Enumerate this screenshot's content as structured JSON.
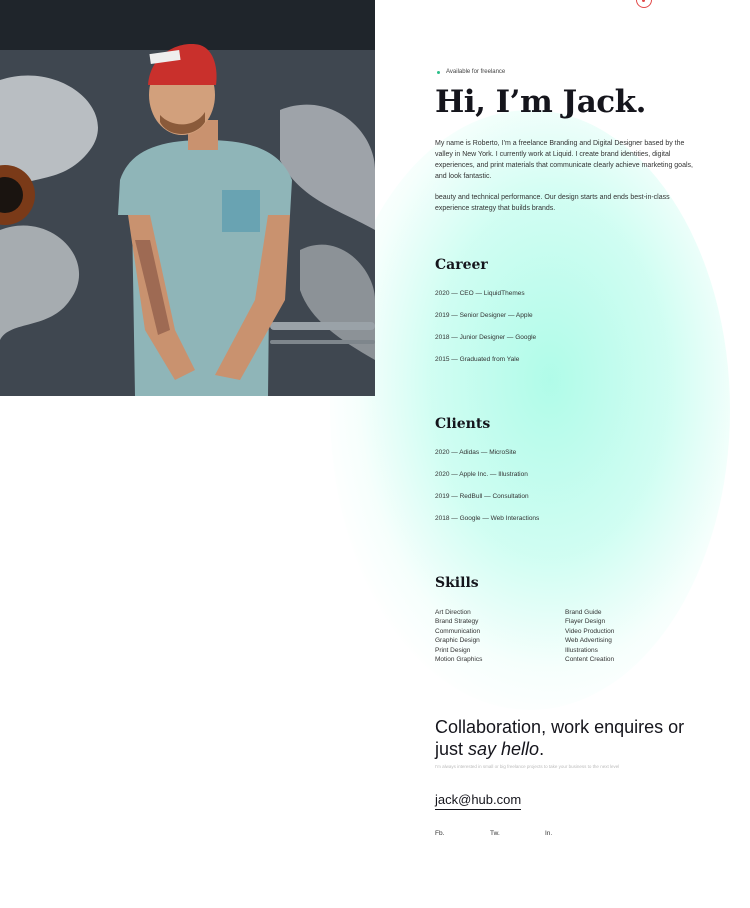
{
  "status": "Available for freelance",
  "hero_title": "Hi, I’m Jack.",
  "bio_1": "My name is Roberto, I’m a freelance Branding and Digital Designer based by the valley in New York. I currently work at Liquid. I create brand identities, digital experiences, and print materials that communicate clearly achieve marketing goals, and look fantastic.",
  "bio_2": "beauty and technical performance. Our design starts and ends best-in-class experience strategy that builds brands.",
  "career": {
    "title": "Career",
    "items": [
      "2020 — CEO — LiquidThemes",
      "2019 — Senior Designer — Apple",
      "2018 — Junior Designer — Google",
      "2015 — Graduated from Yale"
    ]
  },
  "clients": {
    "title": "Clients",
    "items": [
      "2020 — Adidas — MicroSite",
      "2020 — Apple Inc. — Illustration",
      "2019 — RedBull — Consultation",
      "2018 — Google — Web Interactions"
    ]
  },
  "skills": {
    "title": "Skills",
    "col1": [
      "Art Direction",
      "Brand Strategy",
      "Communication",
      "Graphic Design",
      "Print Design",
      "Motion Graphics"
    ],
    "col2": [
      "Brand Guide",
      "Flayer Design",
      "Video Production",
      "Web Advertising",
      "Illustrations",
      "Content Creation"
    ]
  },
  "collab": {
    "line1": "Collaboration, work enquires or",
    "line2_prefix": "just ",
    "line2_em": "say hello",
    "line2_suffix": ".",
    "note": "I'm always interested in small or big freelance projects to take your business to the next level"
  },
  "email": "jack@hub.com",
  "social": [
    "Fb.",
    "Tw.",
    "In."
  ],
  "colors": {
    "accent_glow": "#96fae1",
    "status_dot": "#2bbf8a",
    "top_icon": "#e24a4a",
    "text_dark": "#15151c"
  }
}
